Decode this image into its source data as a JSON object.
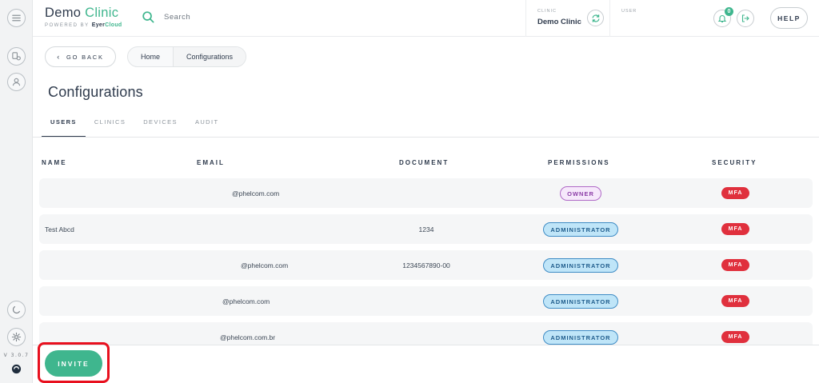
{
  "app": {
    "brand_demo": "Demo",
    "brand_clinic": "Clinic",
    "powered_by": "POWERED BY",
    "eyer": "Eyer",
    "cloud": "Cloud",
    "version": "V 3.0.7"
  },
  "header": {
    "search_label": "Search",
    "clinic_label": "CLINIC",
    "clinic_name": "Demo Clinic",
    "user_label": "USER",
    "notification_count": "0",
    "help_label": "HELP"
  },
  "nav": {
    "back_label": "GO BACK",
    "breadcrumbs": [
      "Home",
      "Configurations"
    ]
  },
  "page": {
    "title": "Configurations",
    "tabs": [
      {
        "label": "USERS",
        "active": true
      },
      {
        "label": "CLINICS",
        "active": false
      },
      {
        "label": "DEVICES",
        "active": false
      },
      {
        "label": "AUDIT",
        "active": false
      }
    ]
  },
  "table": {
    "columns": [
      "NAME",
      "EMAIL",
      "DOCUMENT",
      "PERMISSIONS",
      "SECURITY"
    ],
    "rows": [
      {
        "name": "",
        "email": "@phelcom.com",
        "document": "",
        "permission": "OWNER",
        "security": "MFA"
      },
      {
        "name": "Test Abcd",
        "email": "",
        "document": "1234",
        "permission": "ADMINISTRATOR",
        "security": "MFA"
      },
      {
        "name": "",
        "email": "@phelcom.com",
        "document": "1234567890-00",
        "permission": "ADMINISTRATOR",
        "security": "MFA"
      },
      {
        "name": "",
        "email": "@phelcom.com",
        "document": "",
        "permission": "ADMINISTRATOR",
        "security": "MFA"
      },
      {
        "name": "",
        "email": "@phelcom.com.br",
        "document": "",
        "permission": "ADMINISTRATOR",
        "security": "MFA"
      }
    ]
  },
  "actions": {
    "invite_label": "INVITE"
  },
  "colors": {
    "accent": "#3fb68e",
    "owner": "#b06ac7",
    "admin": "#3e8cc5",
    "mfa": "#e0303d",
    "highlight": "#e8101e"
  }
}
